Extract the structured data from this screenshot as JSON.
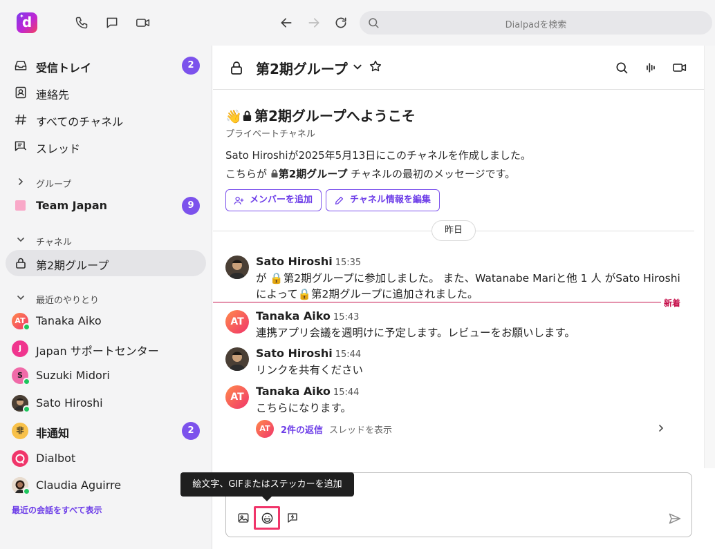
{
  "topbar": {
    "logo_letter": "d",
    "icons": [
      "phone-icon",
      "chat-icon",
      "video-icon",
      "back-icon",
      "forward-icon",
      "refresh-icon"
    ],
    "search_placeholder": "Dialpadを検索"
  },
  "sidebar": {
    "nav": [
      {
        "label": "受信トレイ",
        "badge": "2",
        "icon": "inbox-icon"
      },
      {
        "label": "連絡先",
        "icon": "contacts-icon"
      },
      {
        "label": "すべてのチャネル",
        "icon": "hash-icon"
      },
      {
        "label": "スレッド",
        "icon": "threads-icon"
      }
    ],
    "groups_header": "グループ",
    "groups": [
      {
        "label": "Team Japan",
        "badge": "9",
        "color": "#f9a8c8"
      }
    ],
    "channels_header": "チャネル",
    "channels": [
      {
        "label": "第2期グループ"
      }
    ],
    "recent_header": "最近のやりとり",
    "recent": [
      {
        "label": "Tanaka Aiko",
        "initials": "AT"
      },
      {
        "label": "Japan サポートセンター",
        "initials": "J"
      },
      {
        "label": "Suzuki Midori",
        "initials": "S"
      },
      {
        "label": "Sato Hiroshi"
      },
      {
        "label": "非通知",
        "initials": "非",
        "badge": "2"
      },
      {
        "label": "Dialbot"
      },
      {
        "label": "Claudia Aguirre"
      }
    ],
    "show_all": "最近の会話をすべて表示"
  },
  "header": {
    "title": "第2期グループ",
    "icons": [
      "search-icon",
      "waveform-icon",
      "video-icon"
    ]
  },
  "welcome": {
    "title": "第2期グループへようこそ",
    "subtitle": "プライベートチャネル",
    "created": "Sato Hiroshiが2025年5月13日にこのチャネルを作成しました。",
    "first_pre": "こちらが",
    "first_channel": "第2期グループ",
    "first_post": "チャネルの最初のメッセージです。",
    "add_members": "メンバーを追加",
    "edit_info": "チャネル情報を編集"
  },
  "day_divider": "昨日",
  "new_label": "新着",
  "messages": [
    {
      "name": "Sato Hiroshi",
      "time": "15:35",
      "text": "が 🔒第2期グループに参加しました。 また、Watanabe Mariと他 1 人 がSato Hiroshiによって🔒第2期グループに追加されました。"
    },
    {
      "name": "Tanaka Aiko",
      "time": "15:43",
      "initials": "AT",
      "text": "連携アプリ会議を週明けに予定します。レビューをお願いします。"
    },
    {
      "name": "Sato Hiroshi",
      "time": "15:44",
      "text": "リンクを共有ください"
    },
    {
      "name": "Tanaka Aiko",
      "time": "15:44",
      "initials": "AT",
      "text": "こちらになります。"
    }
  ],
  "thread": {
    "initials": "AT",
    "replies": "2件の返信",
    "view": "スレッドを表示"
  },
  "tooltip": "絵文字、GIFまたはステッカーを追加",
  "colors": {
    "accent": "#7c52ec",
    "new_marker": "#c6104b",
    "online": "#1ec65d"
  }
}
